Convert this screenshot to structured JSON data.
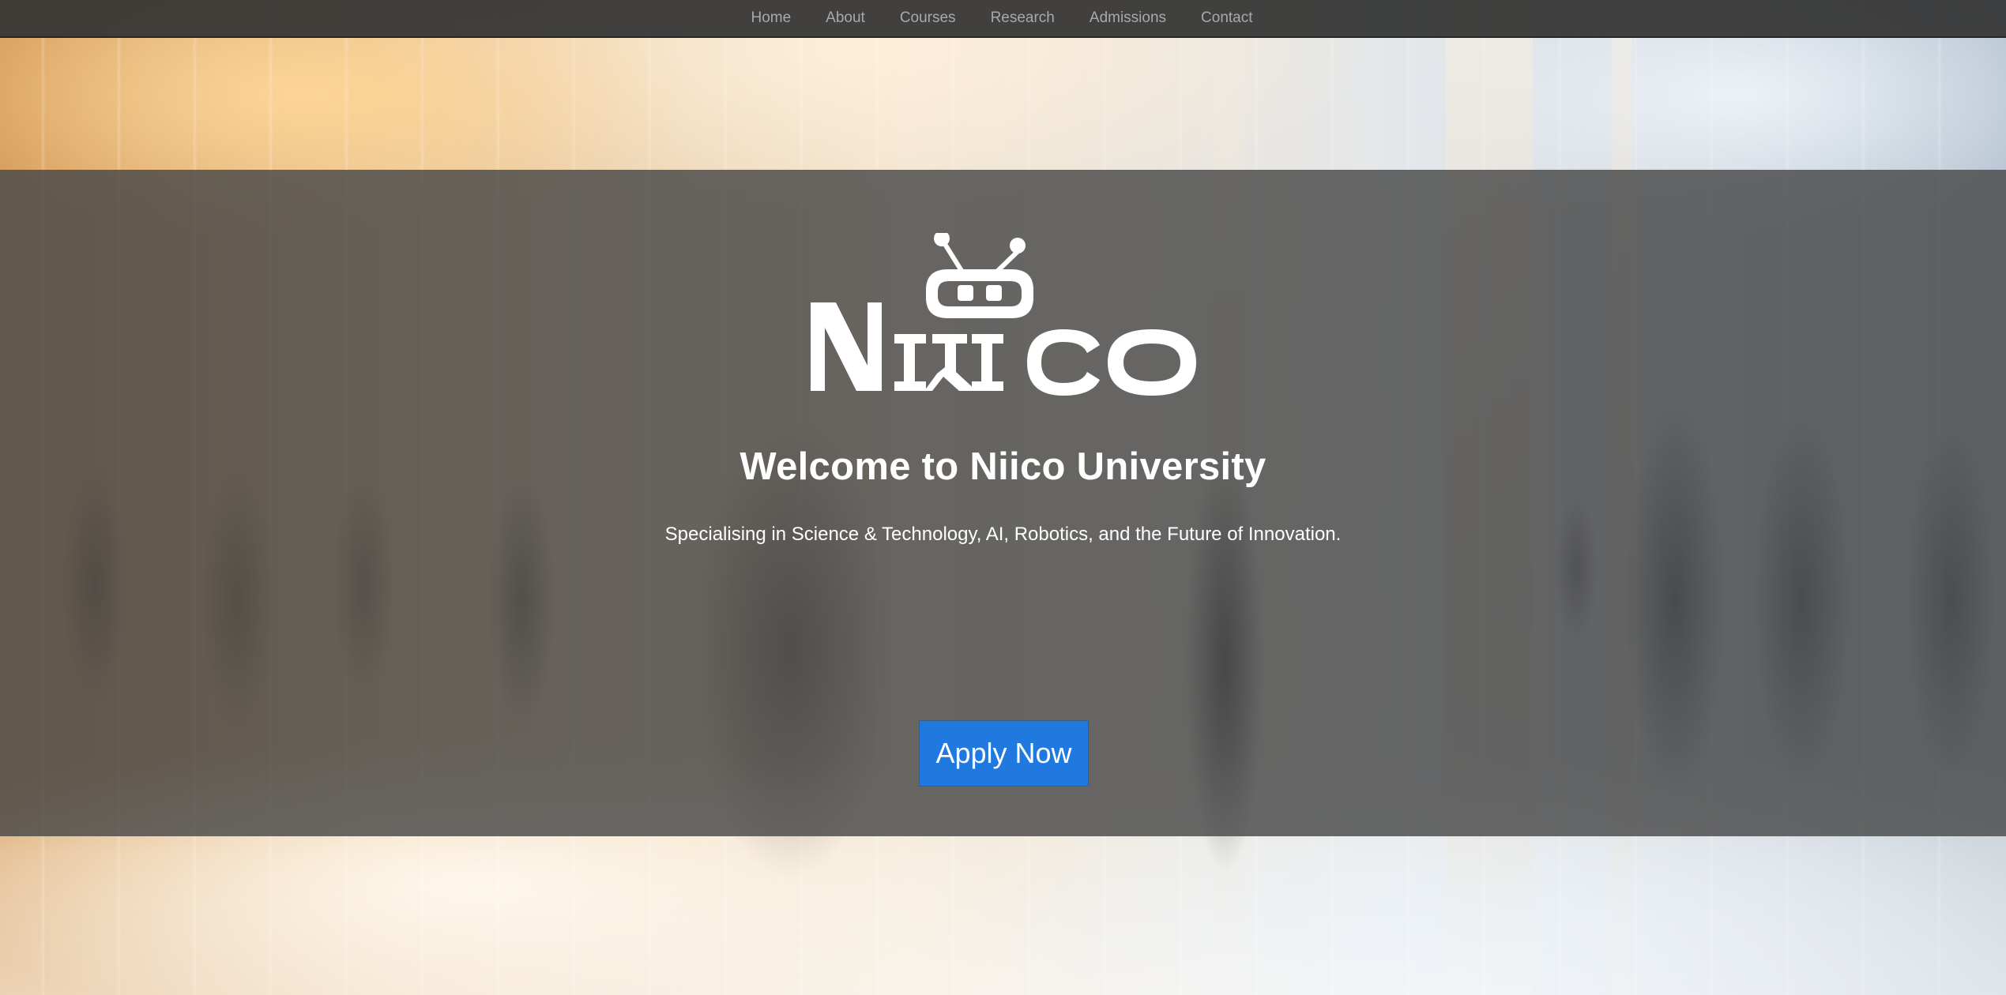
{
  "nav": {
    "items": [
      {
        "label": "Home"
      },
      {
        "label": "About"
      },
      {
        "label": "Courses"
      },
      {
        "label": "Research"
      },
      {
        "label": "Admissions"
      },
      {
        "label": "Contact"
      }
    ]
  },
  "hero": {
    "logo_text": "Niico",
    "title": "Welcome to Niico University",
    "subtitle": "Specialising in Science & Technology, AI, Robotics, and the Future of Innovation.",
    "cta_label": "Apply Now"
  },
  "colors": {
    "nav_background": "#333333",
    "nav_text": "#a9a9a9",
    "hero_overlay": "#484848",
    "cta_background": "#1f79de",
    "text_primary": "#ffffff"
  },
  "icons": {
    "logo": "robot-head-logo"
  }
}
